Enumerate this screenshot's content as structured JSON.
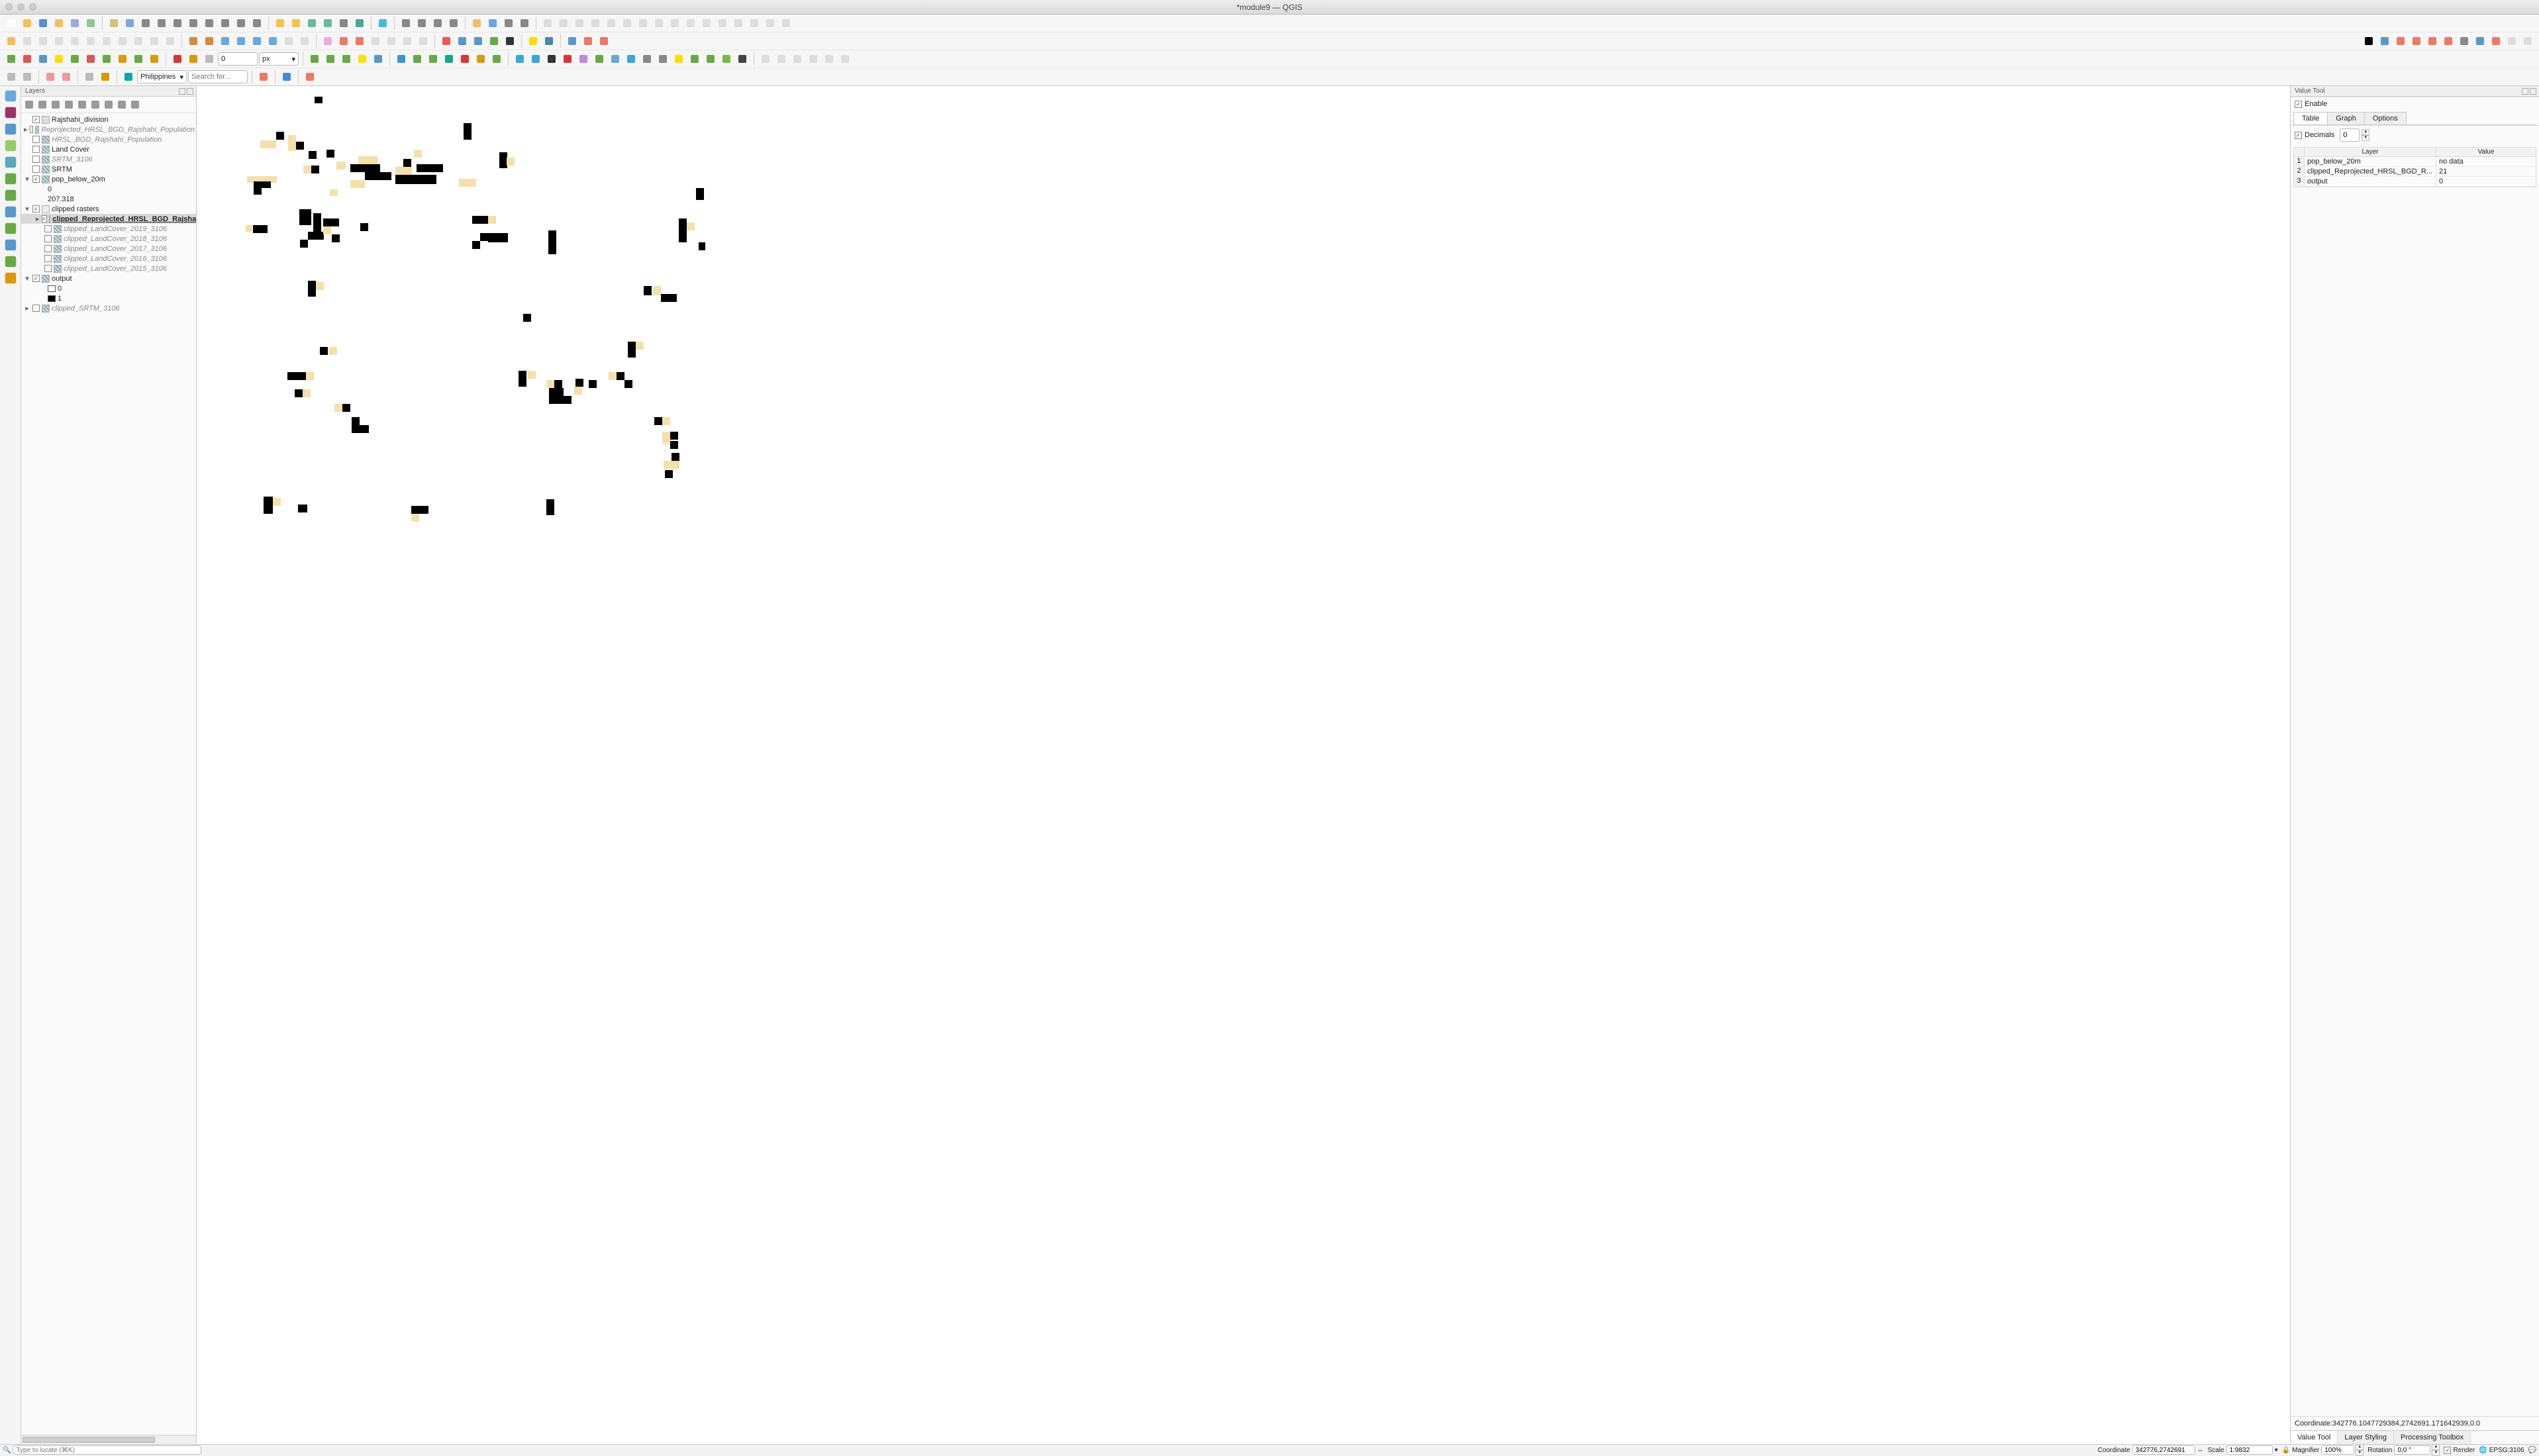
{
  "window": {
    "title": "*module9 — QGIS"
  },
  "search": {
    "region": "Philippines",
    "placeholder": "Search for..."
  },
  "row3": {
    "spin_value": "0",
    "spin_unit": "px"
  },
  "locator": {
    "placeholder": "Type to locate (⌘K)"
  },
  "layers": {
    "panel_title": "Layers",
    "items": [
      {
        "depth": 0,
        "tw": "",
        "chk": true,
        "icon": "vec",
        "label": "Rajshahi_division"
      },
      {
        "depth": 0,
        "tw": "▸",
        "chk": false,
        "icon": "rast",
        "label": "Reprojected_HRSL_BGD_Rajshahi_Population",
        "style": "italic"
      },
      {
        "depth": 0,
        "tw": "",
        "chk": false,
        "icon": "rast",
        "label": "HRSL_BGD_Rajshahi_Population",
        "style": "italic"
      },
      {
        "depth": 0,
        "tw": "",
        "chk": false,
        "icon": "rast",
        "label": "Land Cover"
      },
      {
        "depth": 0,
        "tw": "",
        "chk": false,
        "icon": "rast",
        "label": "SRTM_3106",
        "style": "italic"
      },
      {
        "depth": 0,
        "tw": "",
        "chk": false,
        "icon": "rast",
        "label": "SRTM"
      },
      {
        "depth": 0,
        "tw": "▾",
        "chk": true,
        "icon": "rast",
        "label": "pop_below_20m"
      },
      {
        "depth": 2,
        "plain": "0"
      },
      {
        "depth": 2,
        "plain": "207.318"
      },
      {
        "depth": 0,
        "tw": "▾",
        "chk": true,
        "icon": "grp",
        "label": "clipped rasters"
      },
      {
        "depth": 1,
        "tw": "▸",
        "chk": true,
        "icon": "rast",
        "label": "clipped_Reprojected_HRSL_BGD_Rajshahi",
        "style": "bold-u",
        "sel": true
      },
      {
        "depth": 1,
        "tw": "",
        "chk": false,
        "icon": "rast",
        "label": "clipped_LandCover_2019_3106",
        "style": "italic"
      },
      {
        "depth": 1,
        "tw": "",
        "chk": false,
        "icon": "rast",
        "label": "clipped_LandCover_2018_3106",
        "style": "italic"
      },
      {
        "depth": 1,
        "tw": "",
        "chk": false,
        "icon": "rast",
        "label": "clipped_LandCover_2017_3106",
        "style": "italic"
      },
      {
        "depth": 1,
        "tw": "",
        "chk": false,
        "icon": "rast",
        "label": "clipped_LandCover_2016_3106",
        "style": "italic"
      },
      {
        "depth": 1,
        "tw": "",
        "chk": false,
        "icon": "rast",
        "label": "clipped_LandCover_2015_3106",
        "style": "italic"
      },
      {
        "depth": 0,
        "tw": "▾",
        "chk": true,
        "icon": "rast",
        "label": "output"
      },
      {
        "depth": 2,
        "swatch": "#ffffff",
        "plain": "0"
      },
      {
        "depth": 2,
        "swatch": "#000000",
        "plain": "1"
      },
      {
        "depth": 0,
        "tw": "▸",
        "chk": false,
        "icon": "rast",
        "label": "clipped_SRTM_3106",
        "style": "italic"
      }
    ]
  },
  "value_tool": {
    "panel_title": "Value Tool",
    "enable_label": "Enable",
    "decimals_label": "Decimals",
    "decimals_value": "0",
    "tabs": {
      "table": "Table",
      "graph": "Graph",
      "options": "Options"
    },
    "columns": {
      "layer": "Layer",
      "value": "Value"
    },
    "rows": [
      {
        "n": "1",
        "layer": "pop_below_20m",
        "value": "no data"
      },
      {
        "n": "2",
        "layer": "clipped_Reprojected_HRSL_BGD_R...",
        "value": "21"
      },
      {
        "n": "3",
        "layer": "output",
        "value": "0"
      }
    ],
    "coordinate_line": "Coordinate:342776.1047729384,2742691.171642939,0.0",
    "bottom_tabs": {
      "value_tool": "Value Tool",
      "layer_styling": "Layer Styling",
      "toolbox": "Processing Toolbox"
    }
  },
  "status": {
    "coordinate_label": "Coordinate",
    "coordinate_value": "342776,2742691",
    "scale_label": "Scale",
    "scale_value": "1:9832",
    "magnifier_label": "Magnifier",
    "magnifier_value": "100%",
    "rotation_label": "Rotation",
    "rotation_value": "0,0 °",
    "render_label": "Render",
    "epsg": "EPSG:3106"
  },
  "blocks": [
    [
      482,
      152,
      12,
      10,
      "b"
    ],
    [
      707,
      192,
      12,
      25,
      "b"
    ],
    [
      400,
      218,
      24,
      12,
      "y"
    ],
    [
      424,
      205,
      12,
      12,
      "b"
    ],
    [
      442,
      210,
      12,
      24,
      "y"
    ],
    [
      454,
      220,
      12,
      12,
      "b"
    ],
    [
      473,
      234,
      12,
      12,
      "b"
    ],
    [
      465,
      256,
      12,
      12,
      "y"
    ],
    [
      477,
      256,
      12,
      12,
      "b"
    ],
    [
      500,
      232,
      12,
      12,
      "b"
    ],
    [
      515,
      250,
      14,
      12,
      "y"
    ],
    [
      548,
      242,
      30,
      12,
      "y"
    ],
    [
      536,
      254,
      45,
      12,
      "b"
    ],
    [
      558,
      266,
      40,
      12,
      "b"
    ],
    [
      536,
      278,
      22,
      12,
      "y"
    ],
    [
      604,
      258,
      25,
      12,
      "y"
    ],
    [
      604,
      270,
      45,
      14,
      "b"
    ],
    [
      648,
      270,
      18,
      14,
      "b"
    ],
    [
      636,
      254,
      40,
      12,
      "b"
    ],
    [
      616,
      246,
      12,
      12,
      "b"
    ],
    [
      632,
      232,
      12,
      12,
      "y"
    ],
    [
      700,
      276,
      26,
      12,
      "y"
    ],
    [
      761,
      236,
      12,
      24,
      "b"
    ],
    [
      772,
      244,
      12,
      12,
      "y"
    ],
    [
      380,
      272,
      45,
      10,
      "y"
    ],
    [
      390,
      280,
      26,
      10,
      "b"
    ],
    [
      390,
      290,
      12,
      10,
      "b"
    ],
    [
      505,
      292,
      12,
      10,
      "y"
    ],
    [
      378,
      346,
      10,
      10,
      "y"
    ],
    [
      389,
      346,
      22,
      12,
      "b"
    ],
    [
      459,
      322,
      18,
      24,
      "b"
    ],
    [
      480,
      328,
      12,
      32,
      "b"
    ],
    [
      495,
      336,
      24,
      12,
      "b"
    ],
    [
      472,
      356,
      24,
      12,
      "b"
    ],
    [
      460,
      368,
      12,
      12,
      "b"
    ],
    [
      495,
      348,
      12,
      12,
      "y"
    ],
    [
      508,
      360,
      12,
      12,
      "b"
    ],
    [
      551,
      343,
      12,
      12,
      "b"
    ],
    [
      720,
      332,
      24,
      12,
      "b"
    ],
    [
      744,
      332,
      12,
      12,
      "y"
    ],
    [
      732,
      358,
      12,
      12,
      "b"
    ],
    [
      744,
      358,
      30,
      14,
      "b"
    ],
    [
      720,
      370,
      12,
      12,
      "b"
    ],
    [
      835,
      354,
      12,
      36,
      "b"
    ],
    [
      1032,
      336,
      12,
      36,
      "b"
    ],
    [
      1044,
      342,
      12,
      12,
      "y"
    ],
    [
      1058,
      290,
      12,
      18,
      "b"
    ],
    [
      1062,
      372,
      10,
      12,
      "b"
    ],
    [
      472,
      430,
      12,
      24,
      "b"
    ],
    [
      484,
      432,
      12,
      12,
      "y"
    ],
    [
      979,
      438,
      12,
      14,
      "b"
    ],
    [
      993,
      438,
      12,
      14,
      "y"
    ],
    [
      1005,
      450,
      24,
      12,
      "b"
    ],
    [
      797,
      480,
      12,
      12,
      "b"
    ],
    [
      490,
      530,
      12,
      12,
      "b"
    ],
    [
      504,
      530,
      12,
      12,
      "y"
    ],
    [
      955,
      522,
      12,
      24,
      "b"
    ],
    [
      967,
      522,
      12,
      12,
      "y"
    ],
    [
      441,
      568,
      28,
      12,
      "b"
    ],
    [
      469,
      568,
      12,
      12,
      "y"
    ],
    [
      452,
      594,
      12,
      12,
      "b"
    ],
    [
      464,
      594,
      12,
      12,
      "y"
    ],
    [
      512,
      616,
      12,
      12,
      "y"
    ],
    [
      524,
      616,
      12,
      12,
      "b"
    ],
    [
      790,
      566,
      12,
      24,
      "b"
    ],
    [
      804,
      566,
      12,
      12,
      "y"
    ],
    [
      832,
      580,
      12,
      12,
      "y"
    ],
    [
      844,
      580,
      12,
      12,
      "b"
    ],
    [
      836,
      592,
      22,
      24,
      "b"
    ],
    [
      858,
      604,
      12,
      12,
      "b"
    ],
    [
      874,
      590,
      12,
      12,
      "y"
    ],
    [
      876,
      578,
      12,
      12,
      "b"
    ],
    [
      896,
      580,
      12,
      12,
      "b"
    ],
    [
      926,
      568,
      12,
      12,
      "y"
    ],
    [
      938,
      568,
      12,
      12,
      "b"
    ],
    [
      950,
      580,
      12,
      12,
      "b"
    ],
    [
      538,
      636,
      12,
      24,
      "b"
    ],
    [
      550,
      648,
      14,
      12,
      "b"
    ],
    [
      995,
      636,
      12,
      12,
      "b"
    ],
    [
      1007,
      636,
      12,
      12,
      "y"
    ],
    [
      1007,
      658,
      12,
      18,
      "y"
    ],
    [
      1019,
      658,
      12,
      12,
      "b"
    ],
    [
      1019,
      672,
      12,
      12,
      "b"
    ],
    [
      1009,
      702,
      24,
      12,
      "y"
    ],
    [
      1021,
      690,
      12,
      12,
      "b"
    ],
    [
      1011,
      716,
      12,
      12,
      "b"
    ],
    [
      405,
      756,
      14,
      26,
      "b"
    ],
    [
      419,
      758,
      12,
      12,
      "y"
    ],
    [
      457,
      768,
      14,
      12,
      "b"
    ],
    [
      628,
      770,
      12,
      12,
      "b"
    ],
    [
      640,
      770,
      14,
      12,
      "b"
    ],
    [
      628,
      782,
      12,
      12,
      "y"
    ],
    [
      832,
      760,
      12,
      24,
      "b"
    ]
  ]
}
